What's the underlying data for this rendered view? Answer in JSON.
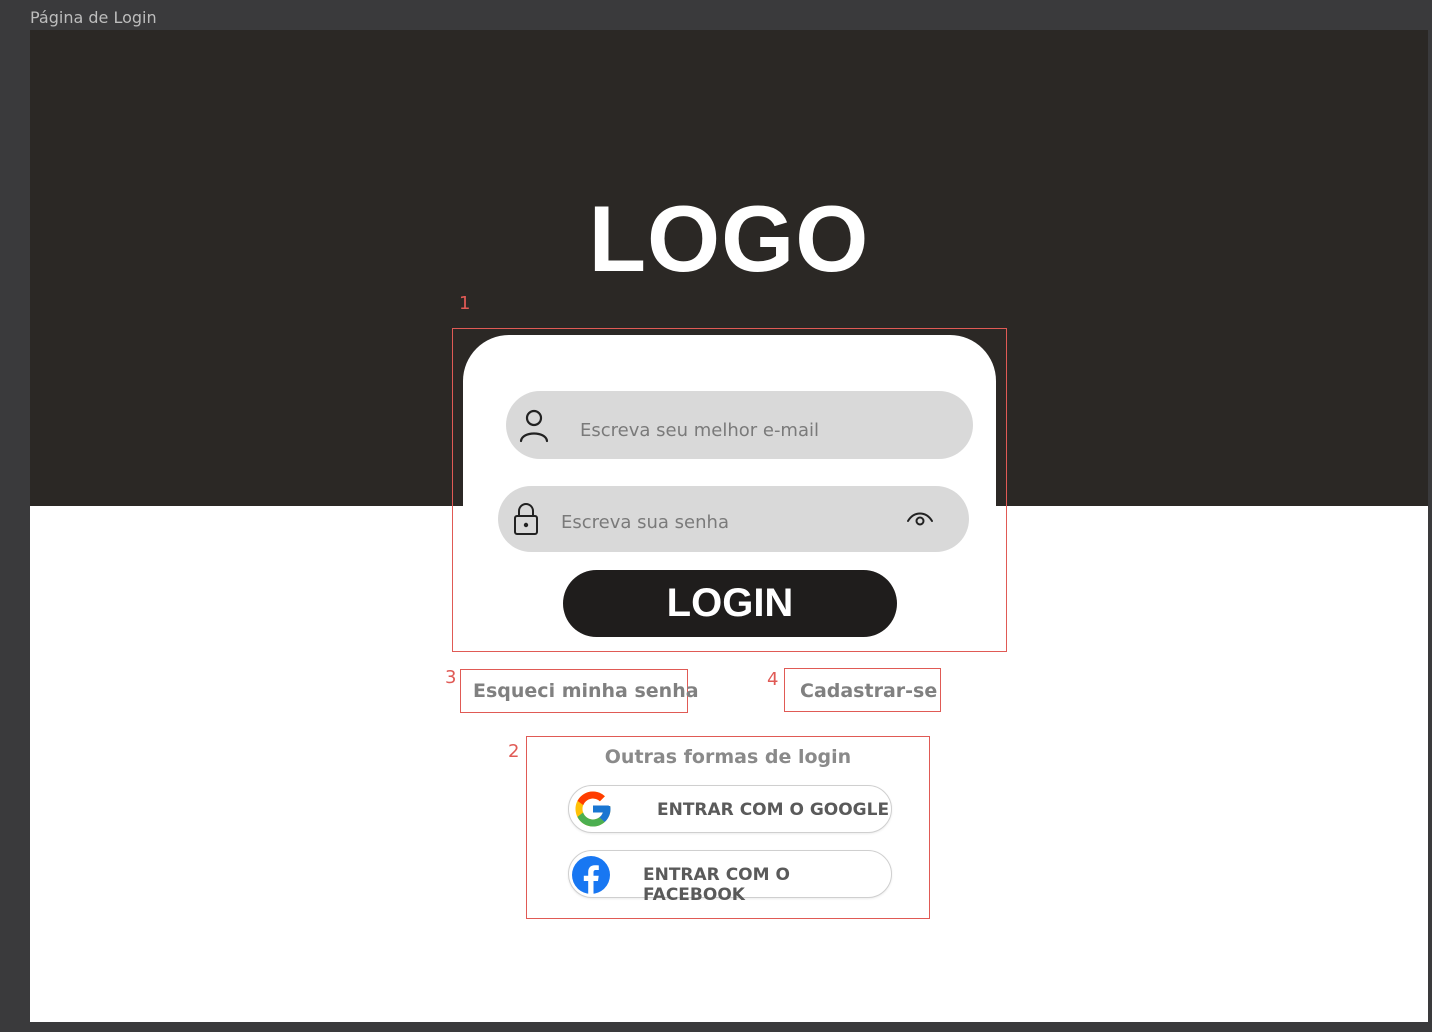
{
  "frame": {
    "label": "Página de Login"
  },
  "colors": {
    "hero_bg": "#2b2825",
    "annotation": "#e05a55",
    "button_dark": "#1f1d1c",
    "field_bg": "#d9d9d9"
  },
  "logo": {
    "text": "LOGO"
  },
  "annotations": {
    "n1": "1",
    "n2": "2",
    "n3": "3",
    "n4": "4"
  },
  "form": {
    "email": {
      "placeholder": "Escreva seu melhor e-mail",
      "icon": "user-icon"
    },
    "password": {
      "placeholder": "Escreva sua senha",
      "icon": "lock-icon",
      "toggle_icon": "eye-icon"
    },
    "login_label": "LOGIN"
  },
  "links": {
    "forgot": "Esqueci minha senha",
    "signup": "Cadastrar-se"
  },
  "other_logins": {
    "title": "Outras formas de login",
    "google_label": "ENTRAR COM O GOOGLE",
    "facebook_label": "ENTRAR COM O FACEBOOK"
  }
}
